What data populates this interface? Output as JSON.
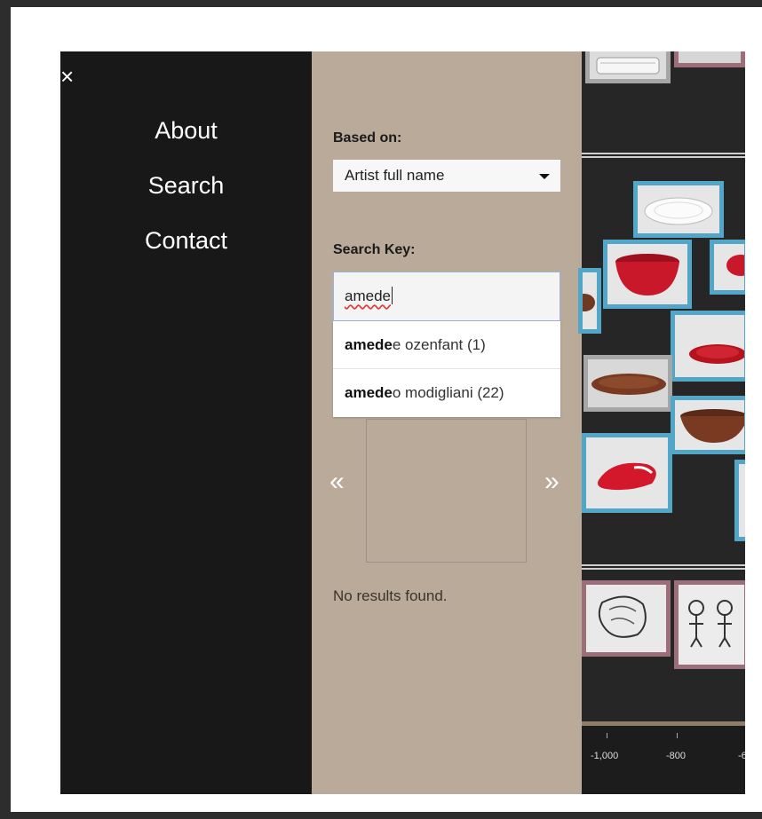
{
  "menu": {
    "close_glyph": "×",
    "items": [
      {
        "label": "About"
      },
      {
        "label": "Search"
      },
      {
        "label": "Contact"
      }
    ]
  },
  "search": {
    "based_on_label": "Based on:",
    "based_on_value": "Artist full name",
    "search_key_label": "Search Key:",
    "search_key_value": "amede",
    "suggestions": [
      {
        "match": "amede",
        "rest": "e ozenfant (1)"
      },
      {
        "match": "amede",
        "rest": "o modigliani (22)"
      }
    ],
    "prev_glyph": "«",
    "next_glyph": "»",
    "status": "No results found."
  },
  "timeline": {
    "ticks": [
      "-1,000",
      "-800",
      "-6"
    ]
  },
  "colors": {
    "menu_bg": "#181818",
    "panel_bg": "#b9aa99",
    "thumb_border": "#52a7c8",
    "object_red": "#c8182a",
    "object_brown": "#7a3a22"
  }
}
